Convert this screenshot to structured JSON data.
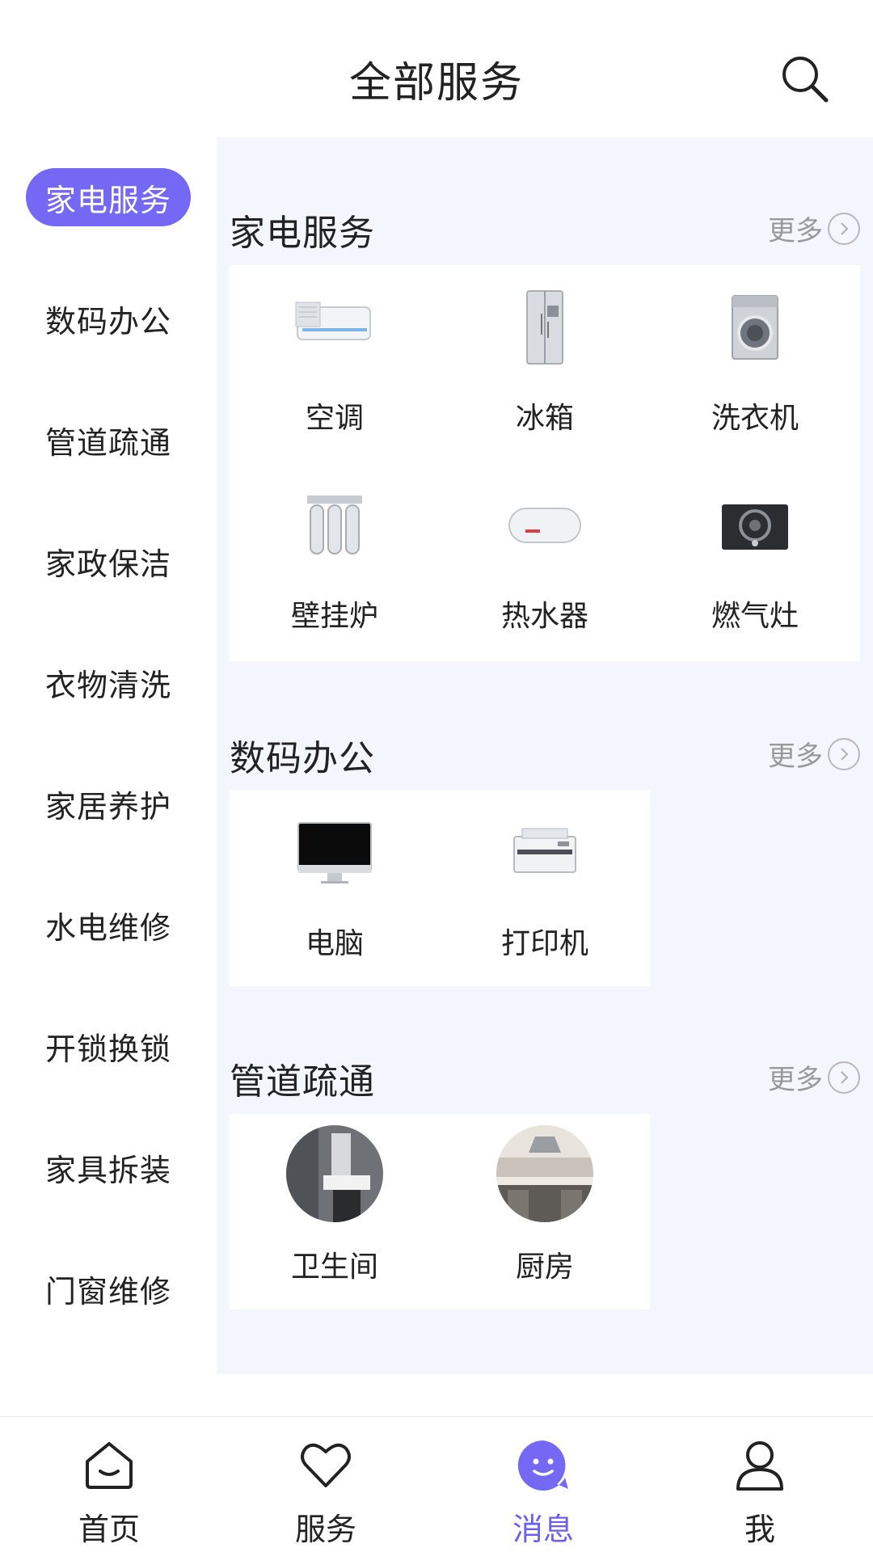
{
  "header": {
    "title": "全部服务",
    "search_icon": "search-icon"
  },
  "sidebar": {
    "items": [
      {
        "label": "家电服务",
        "active": true
      },
      {
        "label": "数码办公"
      },
      {
        "label": "管道疏通"
      },
      {
        "label": "家政保洁"
      },
      {
        "label": "衣物清洗"
      },
      {
        "label": "家居养护"
      },
      {
        "label": "水电维修"
      },
      {
        "label": "开锁换锁"
      },
      {
        "label": "家具拆装"
      },
      {
        "label": "门窗维修"
      }
    ]
  },
  "sections": [
    {
      "title": "家电服务",
      "more_label": "更多",
      "items": [
        {
          "label": "空调",
          "icon": "air-conditioner-icon"
        },
        {
          "label": "冰箱",
          "icon": "refrigerator-icon"
        },
        {
          "label": "洗衣机",
          "icon": "washing-machine-icon"
        },
        {
          "label": "壁挂炉",
          "icon": "wall-boiler-icon"
        },
        {
          "label": "热水器",
          "icon": "water-heater-icon"
        },
        {
          "label": "燃气灶",
          "icon": "gas-stove-icon"
        }
      ]
    },
    {
      "title": "数码办公",
      "more_label": "更多",
      "items": [
        {
          "label": "电脑",
          "icon": "computer-icon"
        },
        {
          "label": "打印机",
          "icon": "printer-icon"
        }
      ]
    },
    {
      "title": "管道疏通",
      "more_label": "更多",
      "items": [
        {
          "label": "卫生间",
          "icon": "bathroom-photo-icon"
        },
        {
          "label": "厨房",
          "icon": "kitchen-photo-icon"
        }
      ]
    }
  ],
  "tabbar": {
    "tabs": [
      {
        "label": "首页",
        "icon": "home-icon"
      },
      {
        "label": "服务",
        "icon": "heart-icon"
      },
      {
        "label": "消息",
        "icon": "message-icon",
        "active": true
      },
      {
        "label": "我",
        "icon": "user-icon"
      }
    ]
  },
  "colors": {
    "accent": "#7468f5",
    "content_bg": "#f4f6fd",
    "text": "#222222",
    "muted": "#999999"
  }
}
